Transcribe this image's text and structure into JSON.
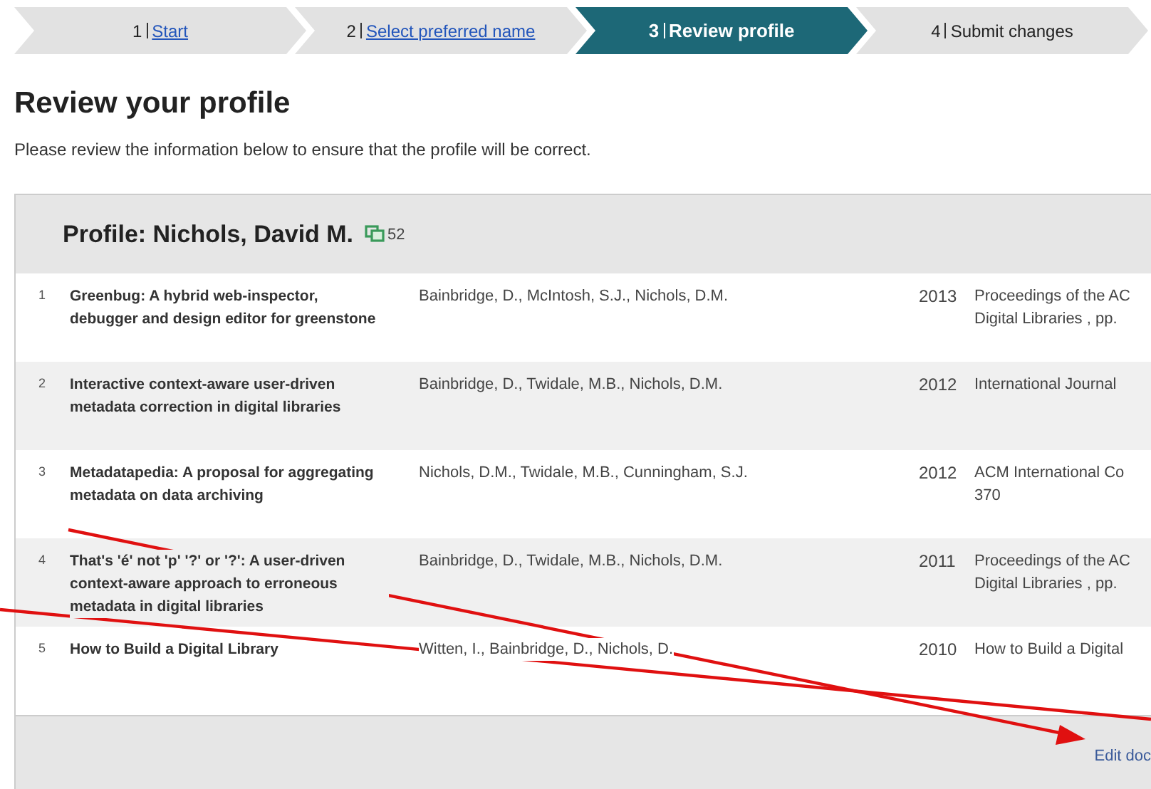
{
  "steps": [
    {
      "number": "1",
      "label": "Start",
      "link": true,
      "selected": false
    },
    {
      "number": "2",
      "label": "Select preferred name",
      "link": true,
      "selected": false
    },
    {
      "number": "3",
      "label": "Review profile",
      "link": false,
      "selected": true
    },
    {
      "number": "4",
      "label": "Submit changes",
      "link": false,
      "selected": false
    }
  ],
  "heading": "Review your profile",
  "intro": "Please review the information below to ensure that the profile will be correct.",
  "profile": {
    "title": "Profile: Nichols, David M.",
    "count": "52"
  },
  "publications": [
    {
      "number": "1",
      "title": "Greenbug: A hybrid web-inspector, debugger and design editor for greenstone",
      "authors": "Bainbridge, D., McIntosh, S.J., Nichols, D.M.",
      "year": "2013",
      "venue": [
        "Proceedings of the AC",
        "Digital Libraries , pp."
      ]
    },
    {
      "number": "2",
      "title": "Interactive context-aware user-driven metadata correction in digital libraries",
      "authors": "Bainbridge, D., Twidale, M.B., Nichols, D.M.",
      "year": "2012",
      "venue": [
        "International Journal"
      ]
    },
    {
      "number": "3",
      "title": "Metadatapedia: A proposal for aggregating metadata on data archiving",
      "authors": "Nichols, D.M., Twidale, M.B., Cunningham, S.J.",
      "year": "2012",
      "venue": [
        "ACM International Co",
        "370"
      ]
    },
    {
      "number": "4",
      "title": "That's 'é' not 'p' '?' or '?': A user-driven context-aware approach to erroneous metadata in digital libraries",
      "authors": "Bainbridge, D., Twidale, M.B., Nichols, D.M.",
      "year": "2011",
      "venue": [
        "Proceedings of the AC",
        "Digital Libraries , pp."
      ]
    },
    {
      "number": "5",
      "title": "How to Build a Digital Library",
      "authors": "Witten, I., Bainbridge, D., Nichols, D.",
      "year": "2010",
      "venue": [
        "How to Build a Digital"
      ]
    }
  ],
  "footer_link": "Edit doc"
}
